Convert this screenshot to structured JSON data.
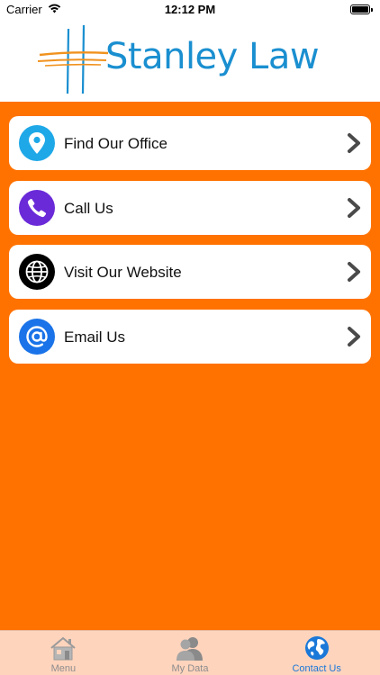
{
  "status_bar": {
    "carrier": "Carrier",
    "time": "12:12 PM"
  },
  "header": {
    "logo_text": "Stanley Law"
  },
  "menu": {
    "items": [
      {
        "label": "Find Our Office",
        "icon": "location-pin-icon",
        "color": "#1ea8e8"
      },
      {
        "label": "Call Us",
        "icon": "phone-icon",
        "color": "#6a2ad8"
      },
      {
        "label": "Visit Our Website",
        "icon": "globe-icon",
        "color": "#000000"
      },
      {
        "label": "Email Us",
        "icon": "at-sign-icon",
        "color": "#1a73e8"
      }
    ]
  },
  "tab_bar": {
    "tabs": [
      {
        "label": "Menu",
        "icon": "home-icon",
        "active": false
      },
      {
        "label": "My Data",
        "icon": "users-icon",
        "active": false
      },
      {
        "label": "Contact Us",
        "icon": "globe-icon",
        "active": true
      }
    ]
  },
  "colors": {
    "background": "#ff7200",
    "brand_blue": "#1a8fd0",
    "tab_bar": "#ffd4bd",
    "active_tab": "#1a78d8"
  }
}
